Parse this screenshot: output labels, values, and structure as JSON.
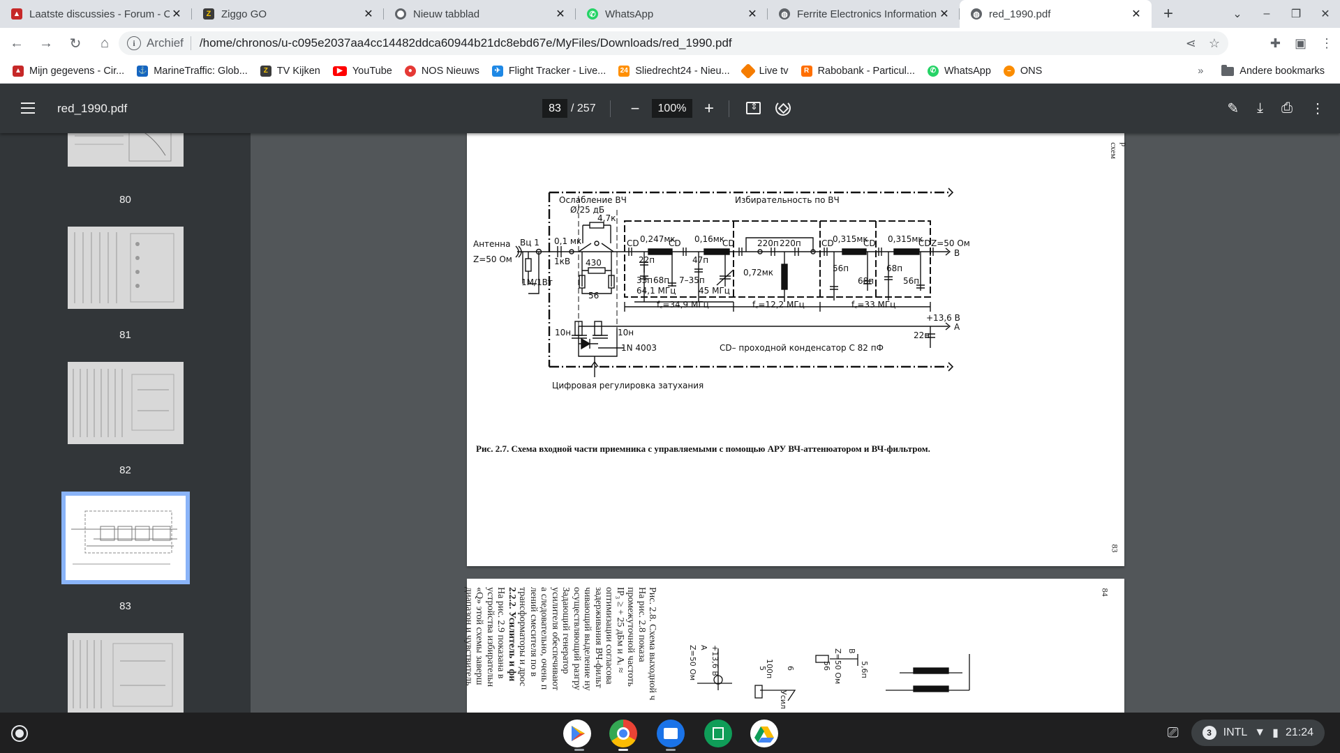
{
  "tabs": [
    {
      "title": "Laatste discussies - Forum - Ci",
      "icon": "forum-icon",
      "color": "#c62828"
    },
    {
      "title": "Ziggo GO",
      "icon": "ziggo-icon",
      "color": "#3a3a3a"
    },
    {
      "title": "Nieuw tabblad",
      "icon": "chrome-icon",
      "color": "#5f6368"
    },
    {
      "title": "WhatsApp",
      "icon": "whatsapp-icon",
      "color": "#25d366"
    },
    {
      "title": "Ferrite Electronics Information",
      "icon": "globe-icon",
      "color": "#5f6368"
    },
    {
      "title": "red_1990.pdf",
      "icon": "globe-icon",
      "color": "#5f6368",
      "active": true
    }
  ],
  "omnibox": {
    "chip": "Archief",
    "url": "/home/chronos/u-c095e2037aa4cc14482ddca60944b21dc8ebd67e/MyFiles/Downloads/red_1990.pdf"
  },
  "bookmarks": [
    {
      "label": "Mijn gegevens - Cir...",
      "color": "#c62828"
    },
    {
      "label": "MarineTraffic: Glob...",
      "color": "#1565c0"
    },
    {
      "label": "TV Kijken",
      "color": "#3a3a3a"
    },
    {
      "label": "YouTube",
      "color": "#ff0000"
    },
    {
      "label": "NOS Nieuws",
      "color": "#e53935"
    },
    {
      "label": "Flight Tracker - Live...",
      "color": "#1e88e5"
    },
    {
      "label": "Sliedrecht24 - Nieu...",
      "color": "#ff8f00"
    },
    {
      "label": "Live tv",
      "color": "#f57c00"
    },
    {
      "label": "Rabobank - Particul...",
      "color": "#ff6f00"
    },
    {
      "label": "WhatsApp",
      "color": "#25d366"
    },
    {
      "label": "ONS",
      "color": "#fb8c00"
    }
  ],
  "bookmarks_more": "»",
  "bookmarks_other": "Andere bookmarks",
  "viewer": {
    "title": "red_1990.pdf",
    "page_current": "83",
    "page_total": "/ 257",
    "zoom": "100%"
  },
  "thumbnails": [
    "80",
    "81",
    "82",
    "83"
  ],
  "schematic": {
    "antenna_label": "Антенна",
    "z_in": "Z=50 Ом",
    "vu1": "Вц 1",
    "r_1m": "1М/1Вт",
    "c_01mk": "0,1 мк",
    "kv1": "1кВ",
    "atten_title": "Ослабление ВЧ",
    "atten_range": "Ø/25 дБ",
    "r_47k": "4,7к",
    "r_430": "430",
    "r_56": "56",
    "sel_title": "Избирательность по ВЧ",
    "l1": "0,247мк",
    "l2": "0,16мк",
    "c220a": "220п",
    "c220b": "220п",
    "l4": "0,315мк",
    "l5": "0,315мк",
    "cd": "CD",
    "z_out": "Z=50 Ом",
    "out_b": "B",
    "c22p": "22п",
    "c33p": "33п",
    "c68a": "68п",
    "f641": "64,1 МГц",
    "c47p": "47п",
    "c735": "7–35п",
    "f45": "45 МГц",
    "l072": "0,72мк",
    "c56a": "56п",
    "c68b": "68п",
    "c68c": "68п",
    "c56b": "56п",
    "fc1": "f꜀=34,9 МГц",
    "fc2": "f꜀=12,2 МГц",
    "fc3": "f꜀=33 МГц",
    "v136": "+13,6 В",
    "out_a": "A",
    "c10n_a": "10н",
    "c10n_b": "10н",
    "c22n": "22н",
    "diode": "1N 4003",
    "cd_note": "CD– проходной конденсатор С 82 пФ",
    "digital_ctrl": "Цифровая  регулировка затухания"
  },
  "caption": "Рис. 2.7. Схема входной части приемника с управляемыми с помощью АРУ ВЧ-аттенюатором и ВЧ-фильтром.",
  "page83_num": "83",
  "page83_side": "р схем",
  "page84": {
    "num": "84",
    "lines": [
      "Рис. 2.8. Схема выходной ч",
      "На рис. 2.8 показа",
      "промежуточной частоть",
      "IP₃ ≥ + 25 дБм и Aᵢ ≈",
      "оптимизации согласова",
      "задерживания ВЧ-фильт",
      "чивающий выделение ну",
      "осуществляющий разгру",
      "Задающий генератор",
      "усилителя обеспечивают",
      "а следовательно, очень п",
      "лений смесителя по в",
      "трансформаторы и дрос",
      "2.2.2. Усилитель и фи",
      "На рис. 2.9 показана в",
      "устройства избирательн",
      "«Q» этой схемы заверш",
      "диапазон и чувствитель"
    ],
    "fig_labels": [
      "Z=50 Ом",
      "A",
      "+13,6 В",
      "100п",
      "Усил",
      "5",
      "6",
      "56",
      "Z=50 Ом",
      "B",
      "5,6п"
    ]
  },
  "status": {
    "badge": "3",
    "layout": "INTL",
    "time": "21:24"
  }
}
